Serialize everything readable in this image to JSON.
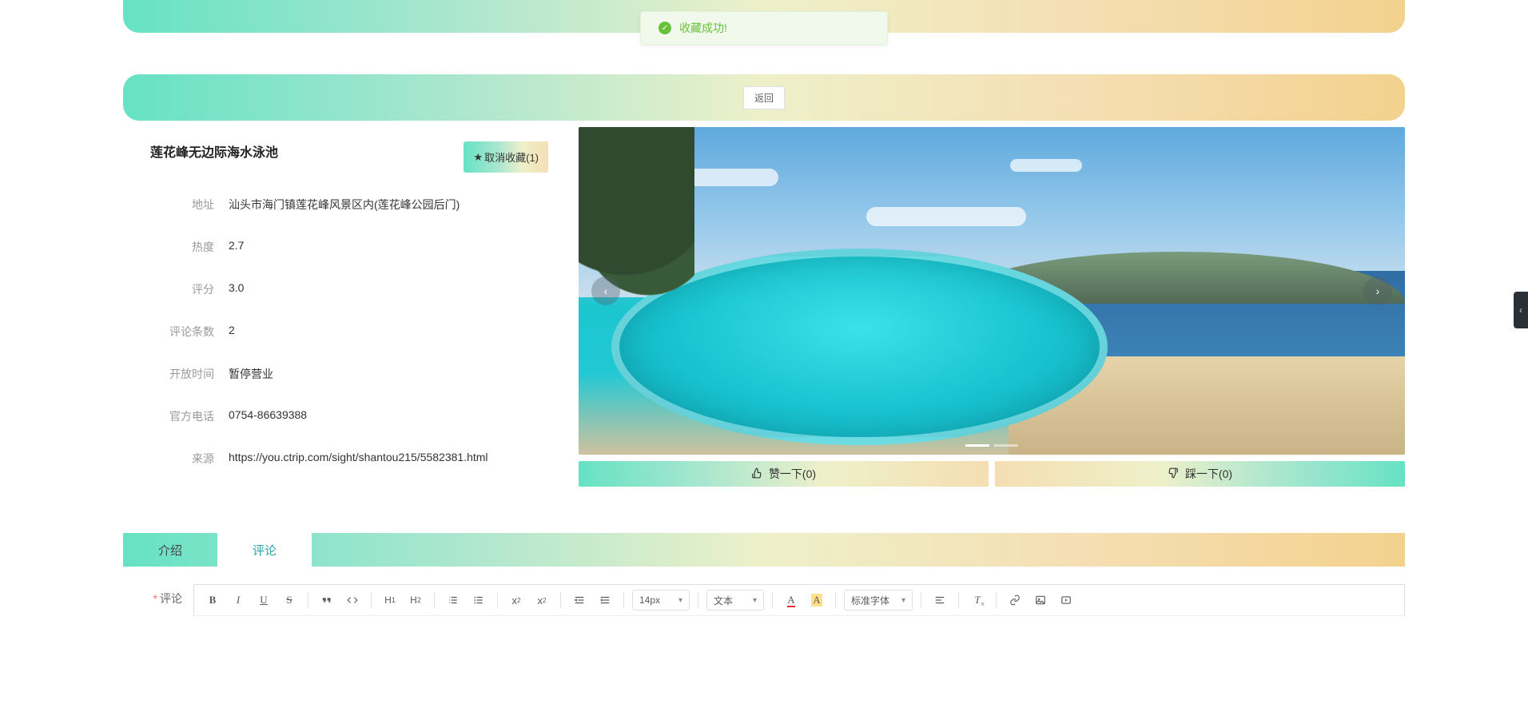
{
  "toast": {
    "text": "收藏成功!"
  },
  "header": {
    "back_label": "返回"
  },
  "poi": {
    "title": "莲花峰无边际海水泳池",
    "fav_button": "取消收藏(1)",
    "fields": {
      "address_label": "地址",
      "address_value": "汕头市海门镇莲花峰风景区内(莲花峰公园后门)",
      "heat_label": "热度",
      "heat_value": "2.7",
      "rating_label": "评分",
      "rating_value": "3.0",
      "reviews_label": "评论条数",
      "reviews_value": "2",
      "hours_label": "开放时间",
      "hours_value": "暂停营业",
      "phone_label": "官方电话",
      "phone_value": "0754-86639388",
      "source_label": "来源",
      "source_value": "https://you.ctrip.com/sight/shantou215/5582381.html"
    }
  },
  "vote": {
    "up_label": "赞一下(0)",
    "down_label": "踩一下(0)"
  },
  "tabs": {
    "intro": "介绍",
    "comments": "评论"
  },
  "editor": {
    "label": "评论",
    "font_size": "14px",
    "element_type": "文本",
    "font_family": "标准字体"
  }
}
